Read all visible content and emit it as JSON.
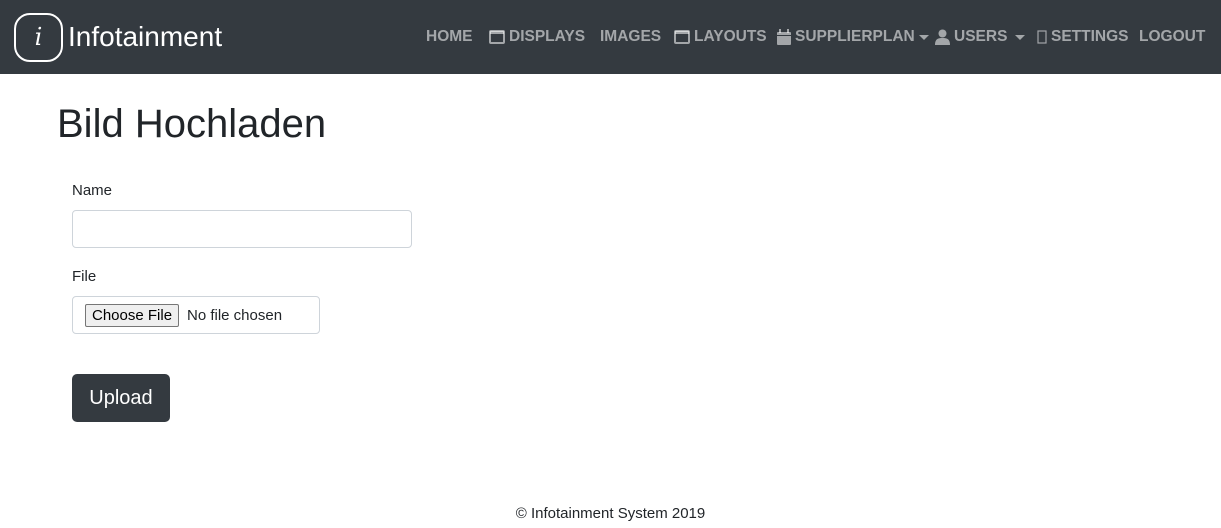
{
  "brand": {
    "logo_glyph": "i",
    "name": "Infotainment"
  },
  "nav": {
    "items": [
      {
        "label": "HOME",
        "icon": "none"
      },
      {
        "label": "DISPLAYS",
        "icon": "window-icon"
      },
      {
        "label": "IMAGES",
        "icon": "none"
      },
      {
        "label": "LAYOUTS",
        "icon": "window-icon"
      },
      {
        "label": "SUPPLIERPLAN",
        "icon": "calendar-icon",
        "dropdown": true
      },
      {
        "label": "USERS",
        "icon": "user-icon",
        "dropdown": true
      },
      {
        "label": "SETTINGS",
        "icon": "missing-glyph-icon"
      },
      {
        "label": "LOGOUT",
        "icon": "none"
      }
    ]
  },
  "page": {
    "title": "Bild Hochladen"
  },
  "form": {
    "name_label": "Name",
    "name_value": "",
    "file_label": "File",
    "choose_file_label": "Choose File",
    "no_file_text": "No file chosen",
    "upload_label": "Upload"
  },
  "footer": {
    "text": "© Infotainment System 2019"
  },
  "colors": {
    "navbar_bg": "#343a40",
    "nav_text": "rgba(255,255,255,0.55)",
    "button_bg": "#343a40"
  }
}
